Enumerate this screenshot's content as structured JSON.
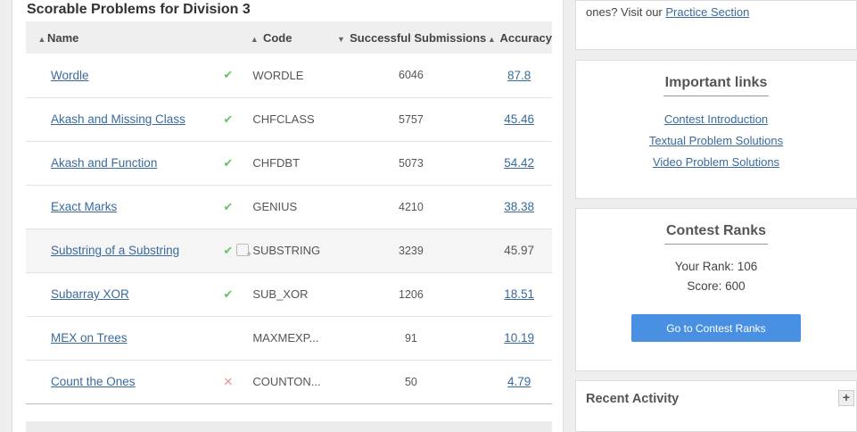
{
  "section_title": "Scorable Problems for Division 3",
  "columns": {
    "name": "Name",
    "code": "Code",
    "subs": "Successful Submissions",
    "accuracy": "Accuracy"
  },
  "problems": [
    {
      "name": "Wordle",
      "status": "✔",
      "code": "WORDLE",
      "subs": "6046",
      "accuracy": "87.8"
    },
    {
      "name": "Akash and Missing Class",
      "status": "✔",
      "code": "CHFCLASS",
      "subs": "5757",
      "accuracy": "45.46"
    },
    {
      "name": "Akash and Function",
      "status": "✔",
      "code": "CHFDBT",
      "subs": "5073",
      "accuracy": "54.42"
    },
    {
      "name": "Exact Marks",
      "status": "✔",
      "code": "GENIUS",
      "subs": "4210",
      "accuracy": "38.38"
    },
    {
      "name": "Substring of a Substring",
      "status": "✔",
      "code": "SUBSTRING",
      "subs": "3239",
      "accuracy": "45.97"
    },
    {
      "name": "Subarray XOR",
      "status": "✔",
      "code": "SUB_XOR",
      "subs": "1206",
      "accuracy": "18.51"
    },
    {
      "name": "MEX on Trees",
      "status": "",
      "code": "MAXMEXP...",
      "subs": "91",
      "accuracy": "10.19"
    },
    {
      "name": "Count the Ones",
      "status": "✕",
      "code": "COUNTON...",
      "subs": "50",
      "accuracy": "4.79"
    }
  ],
  "practice": {
    "text": "ones? Visit our ",
    "link": "Practice Section"
  },
  "important_links": {
    "title": "Important links",
    "items": [
      "Contest Introduction",
      "Textual Problem Solutions",
      "Video Problem Solutions"
    ]
  },
  "contest_ranks": {
    "title": "Contest Ranks",
    "rank_text": "Your Rank: 106",
    "score_text": "Score: 600",
    "button": "Go to Contest Ranks"
  },
  "recent_activity": {
    "title": "Recent Activity",
    "toggle": "+"
  }
}
